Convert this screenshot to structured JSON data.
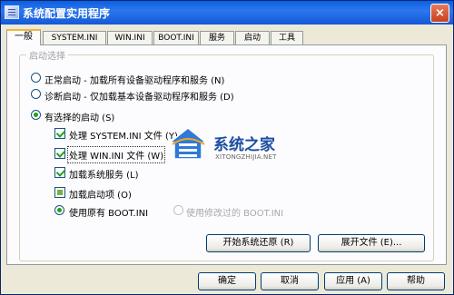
{
  "window": {
    "title": "系统配置实用程序",
    "close_glyph": "×"
  },
  "tabs": [
    {
      "label": "一般",
      "active": true
    },
    {
      "label": "SYSTEM.INI"
    },
    {
      "label": "WIN.INI"
    },
    {
      "label": "BOOT.INI"
    },
    {
      "label": "服务"
    },
    {
      "label": "启动"
    },
    {
      "label": "工具"
    }
  ],
  "startup_group": {
    "legend": "启动选择",
    "normal": "正常启动 - 加载所有设备驱动程序和服务 (N)",
    "diagnostic": "诊断启动 - 仅加载基本设备驱动程序和服务 (D)",
    "selective": "有选择的启动 (S)",
    "process_system_ini": "处理 SYSTEM.INI 文件 (Y)",
    "process_win_ini": "处理 WIN.INI 文件 (W)",
    "load_services": "加载系统服务 (L)",
    "load_startup_items": "加载启动项 (O)",
    "use_original_boot": "使用原有 BOOT.INI",
    "use_modified_boot": "使用修改过的 BOOT.INI"
  },
  "panel_buttons": {
    "restore": "开始系统还原 (R)",
    "expand": "展开文件 (E)..."
  },
  "footer_buttons": {
    "ok": "确定",
    "cancel": "取消",
    "apply": "应用 (A)",
    "help": "帮助"
  },
  "watermark": {
    "title": "系统之家",
    "url": "XITONGZHIJIA.NET"
  },
  "colors": {
    "titlebar": "#2d77ee",
    "check_green": "#21a121",
    "tab_highlight": "#f1b53d"
  }
}
